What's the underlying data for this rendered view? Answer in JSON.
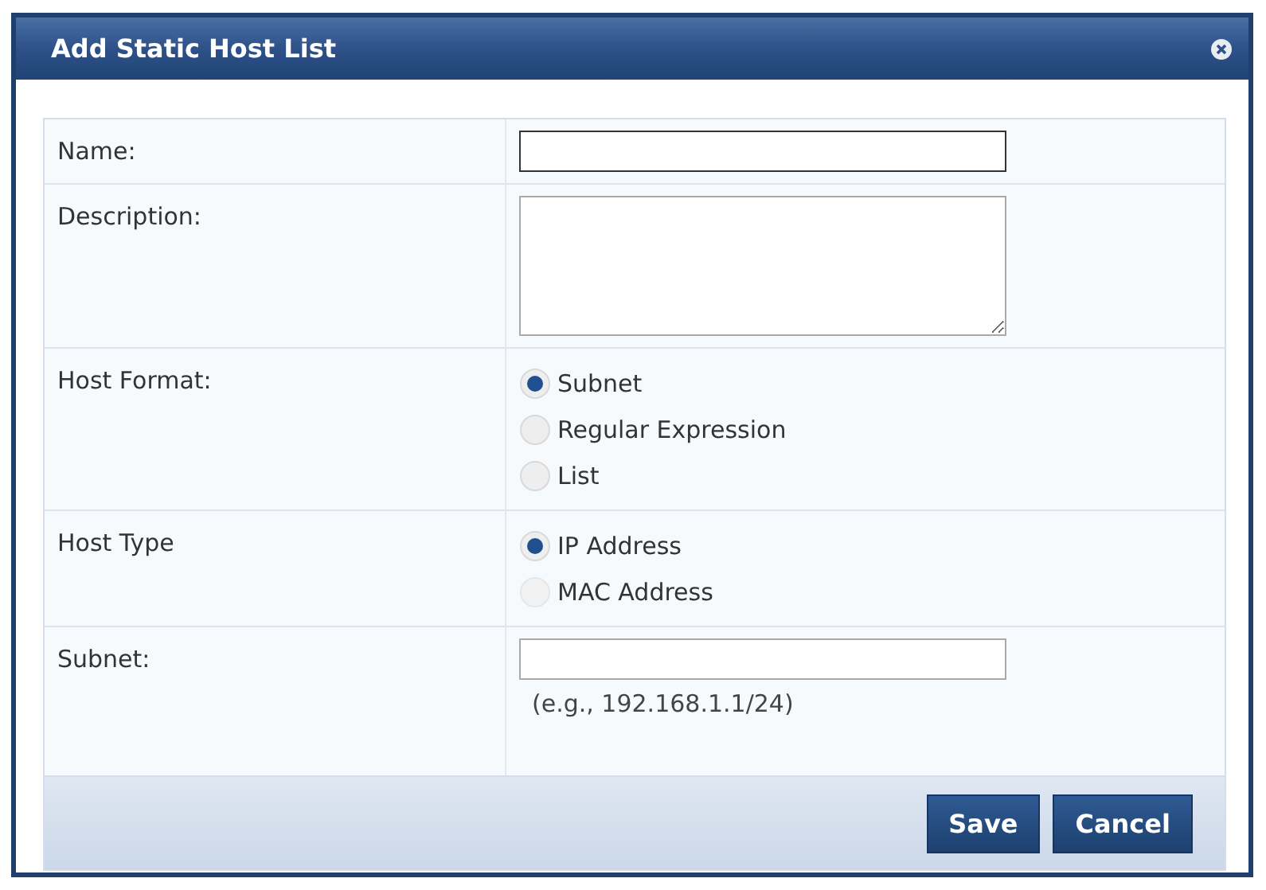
{
  "dialog": {
    "title": "Add Static Host List"
  },
  "rows": [
    {
      "kind": "text",
      "label": "Name:"
    },
    {
      "kind": "textarea",
      "label": "Description:"
    },
    {
      "kind": "radio",
      "label": "Host Format:",
      "options": [
        {
          "label": "Subnet",
          "selected": true,
          "disabled": false
        },
        {
          "label": "Regular Expression",
          "selected": false,
          "disabled": false
        },
        {
          "label": "List",
          "selected": false,
          "disabled": false
        }
      ]
    },
    {
      "kind": "radio",
      "label": "Host Type",
      "options": [
        {
          "label": "IP Address",
          "selected": true,
          "disabled": false
        },
        {
          "label": "MAC Address",
          "selected": false,
          "disabled": true
        }
      ]
    },
    {
      "kind": "text",
      "label": "Subnet:",
      "hint": "(e.g., 192.168.1.1/24)"
    }
  ],
  "buttons": [
    "Save",
    "Cancel"
  ]
}
